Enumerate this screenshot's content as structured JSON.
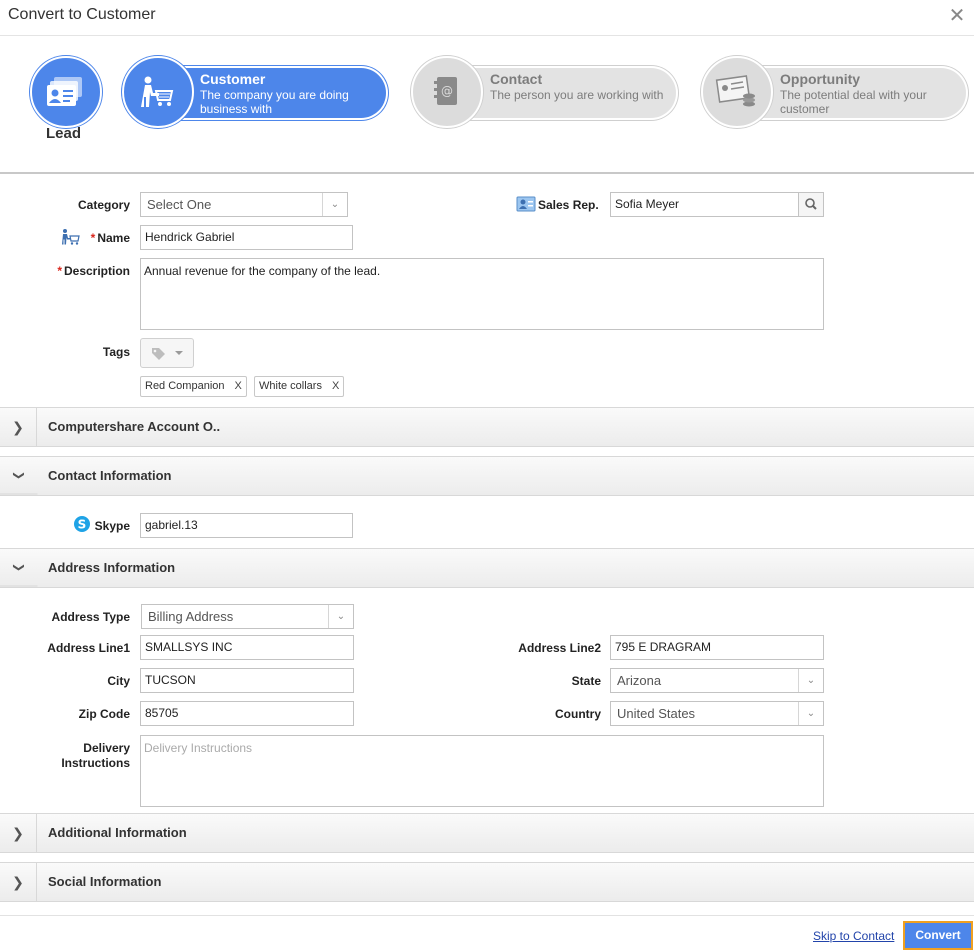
{
  "dialog": {
    "title": "Convert to Customer",
    "close_icon": "close-icon"
  },
  "stepper": {
    "lead": {
      "label": "Lead",
      "icon": "lead-card-icon"
    },
    "customer": {
      "title": "Customer",
      "desc": "The company you are doing business with",
      "icon": "customer-cart-icon"
    },
    "contact": {
      "title": "Contact",
      "desc": "The person you are working with",
      "icon": "address-book-icon"
    },
    "opportunity": {
      "title": "Opportunity",
      "desc": "The potential deal with your customer",
      "icon": "deal-document-icon"
    }
  },
  "form": {
    "category": {
      "label": "Category",
      "value": "Select One"
    },
    "sales_rep": {
      "label": "Sales Rep.",
      "value": "Sofia Meyer"
    },
    "name": {
      "label": "Name",
      "value": "Hendrick Gabriel"
    },
    "description": {
      "label": "Description",
      "value": "Annual revenue for the company of the lead."
    },
    "tags": {
      "label": "Tags",
      "items": [
        "Red Companion",
        "White collars"
      ],
      "remove": "X"
    }
  },
  "sections": {
    "computershare": "Computershare Account O..",
    "contact_info": "Contact Information",
    "address_info": "Address Information",
    "additional_info": "Additional Information",
    "social_info": "Social Information"
  },
  "contact": {
    "skype_label": "Skype",
    "skype_value": "gabriel.13"
  },
  "address": {
    "type_label": "Address Type",
    "type_value": "Billing Address",
    "line1_label": "Address Line1",
    "line1_value": "SMALLSYS INC",
    "line2_label": "Address Line2",
    "line2_value": "795 E DRAGRAM",
    "city_label": "City",
    "city_value": "TUCSON",
    "state_label": "State",
    "state_value": "Arizona",
    "zip_label": "Zip Code",
    "zip_value": "85705",
    "country_label": "Country",
    "country_value": "United States",
    "delivery_label_1": "Delivery",
    "delivery_label_2": "Instructions",
    "delivery_placeholder": "Delivery Instructions"
  },
  "footer": {
    "skip": "Skip to Contact",
    "convert": "Convert"
  },
  "colors": {
    "accent": "#4d86ea",
    "required": "#d9261c",
    "focus_border": "#f0a020"
  }
}
